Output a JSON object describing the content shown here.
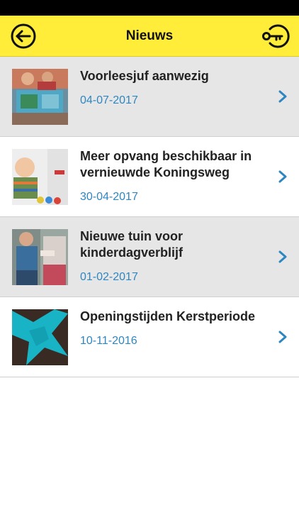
{
  "header": {
    "title": "Nieuws",
    "back_icon": "back-arrow-circle-icon",
    "key_icon": "key-icon"
  },
  "colors": {
    "header_bg": "#ffed3a",
    "date": "#2e86c1",
    "chevron": "#2e86c1",
    "shaded_row": "#e6e6e6"
  },
  "news": [
    {
      "title": "Voorleesjuf aanwezig",
      "date": "04-07-2017",
      "thumb": "children-reading-book"
    },
    {
      "title": "Meer opvang beschikbaar in vernieuwde Koningsweg",
      "date": "30-04-2017",
      "thumb": "smiling-toddler"
    },
    {
      "title": "Nieuwe tuin voor kinderdagverblijf",
      "date": "01-02-2017",
      "thumb": "children-playing-outside"
    },
    {
      "title": "Openingstijden Kerstperiode",
      "date": "10-11-2016",
      "thumb": "turquoise-fabric"
    }
  ]
}
